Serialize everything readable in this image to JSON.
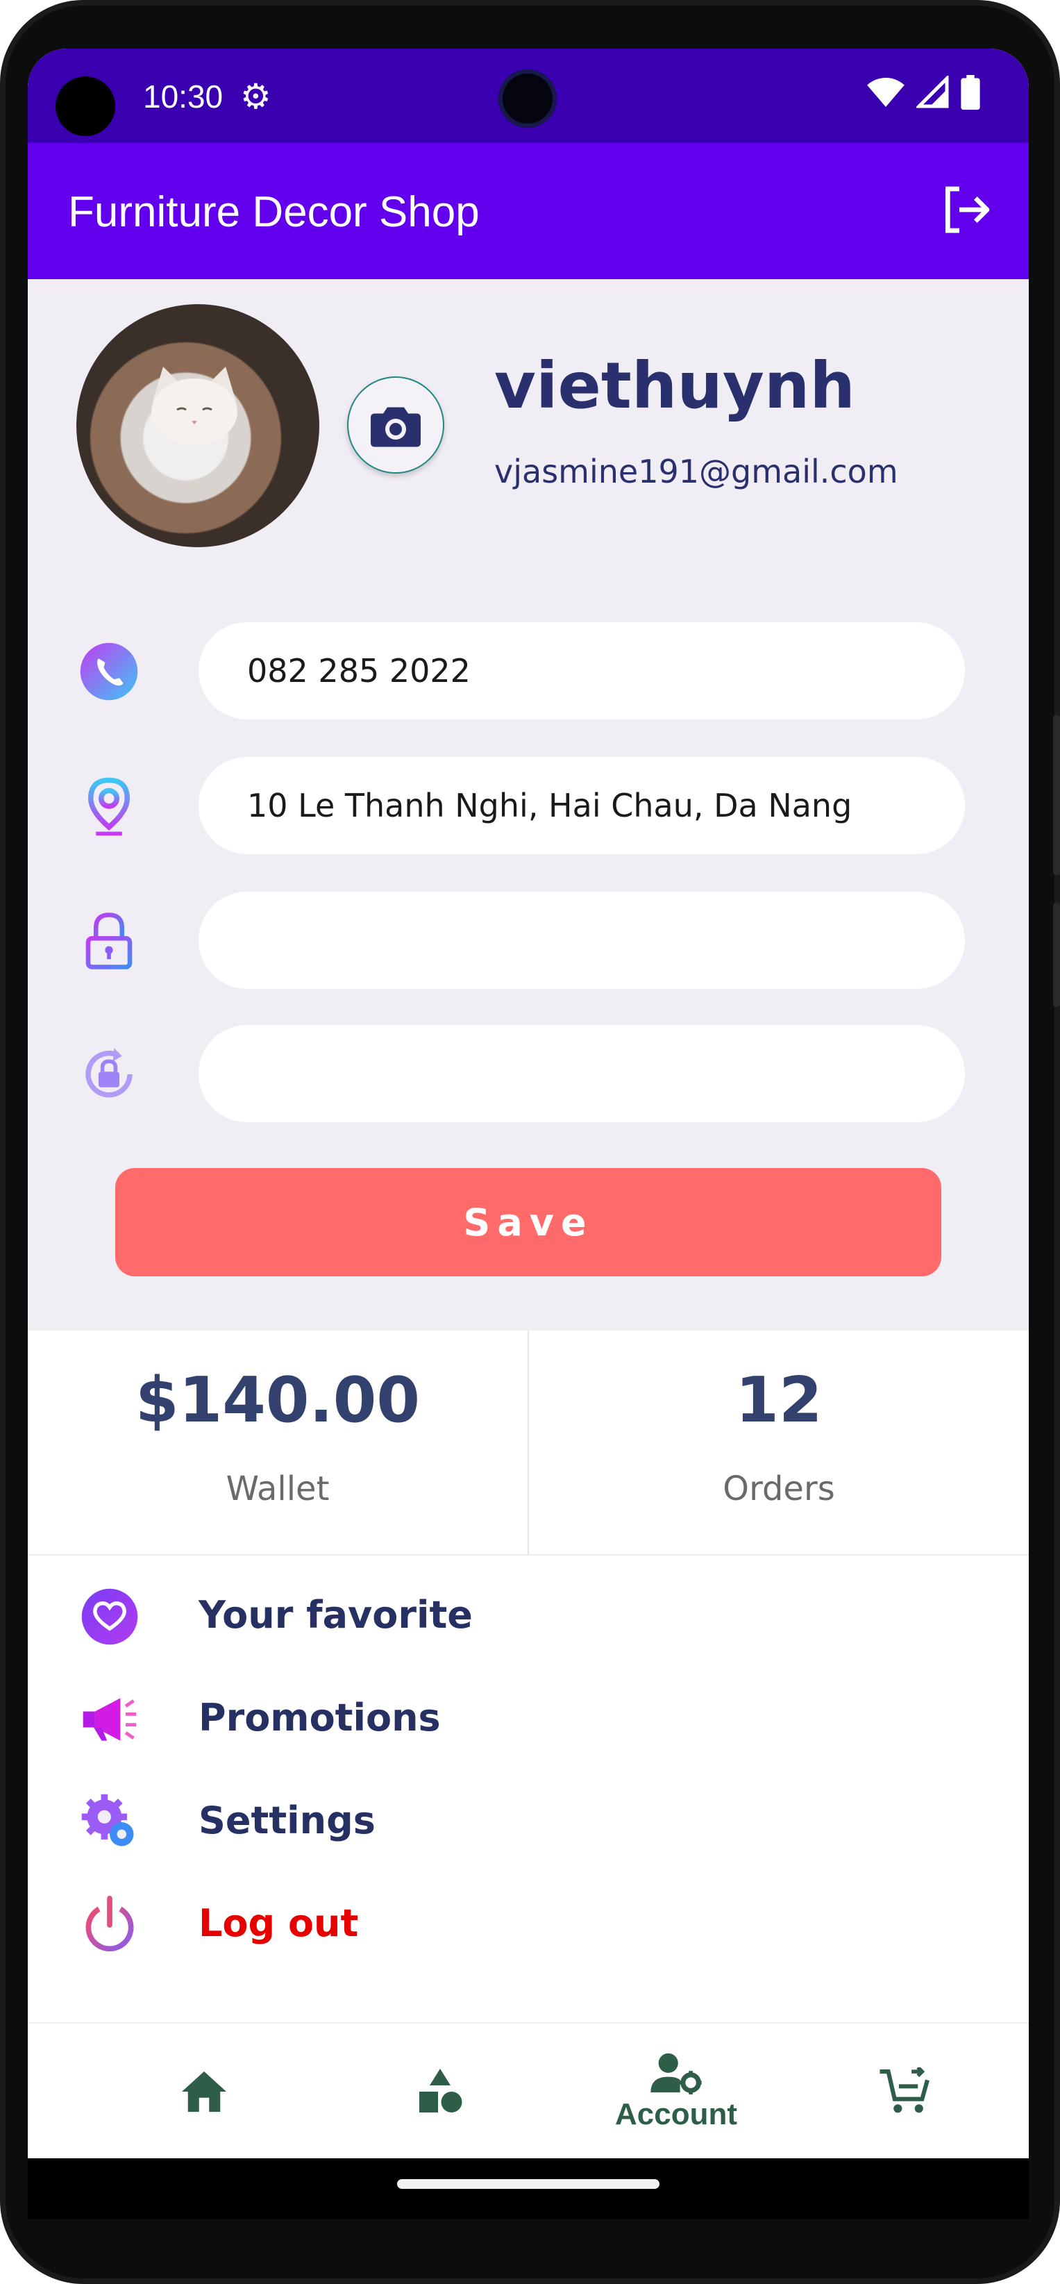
{
  "status_bar": {
    "time": "10:30"
  },
  "app_bar": {
    "title": "Furniture Decor Shop"
  },
  "profile": {
    "username": "viethuynh",
    "email": "vjasmine191@gmail.com",
    "phone": "082 285 2022",
    "address": "10 Le Thanh Nghi, Hai Chau, Da Nang",
    "password": "",
    "confirm_password": ""
  },
  "save_label": "Save",
  "stats": {
    "wallet_value": "$140.00",
    "wallet_label": "Wallet",
    "orders_value": "12",
    "orders_label": "Orders"
  },
  "menu": [
    {
      "label": "Your favorite",
      "icon": "heart-icon"
    },
    {
      "label": "Promotions",
      "icon": "megaphone-icon"
    },
    {
      "label": "Settings",
      "icon": "settings-icon"
    },
    {
      "label": "Log out",
      "icon": "power-icon"
    }
  ],
  "bottom_nav": {
    "items": [
      {
        "icon": "home-icon",
        "label": ""
      },
      {
        "icon": "categories-icon",
        "label": ""
      },
      {
        "icon": "account-icon",
        "label": "Account"
      },
      {
        "icon": "cart-icon",
        "label": ""
      }
    ]
  },
  "colors": {
    "status_bar": "#3a00b0",
    "app_bar": "#6200ee",
    "save_button": "#ff6b6b",
    "logout_text": "#e60000",
    "nav_active": "#2e5e47"
  }
}
